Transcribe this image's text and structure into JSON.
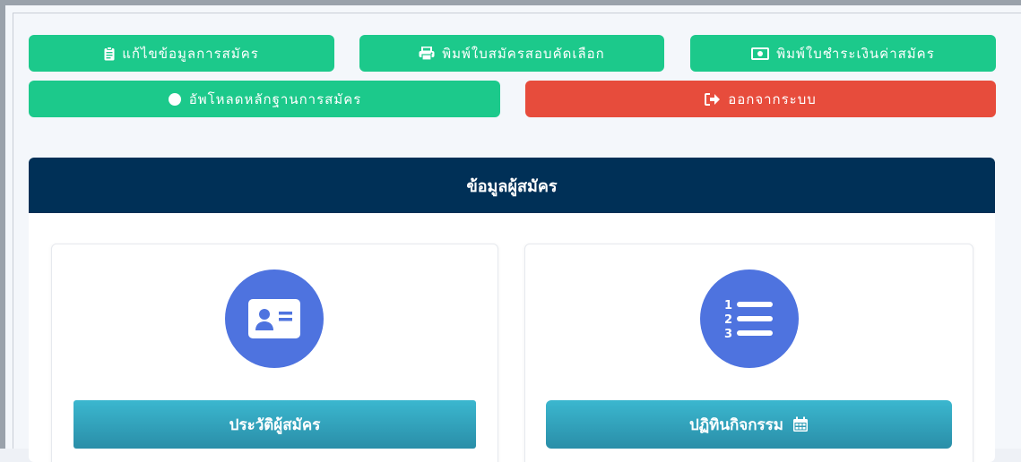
{
  "toolbar": {
    "edit_label": "แก้ไขข้อมูลการสมัคร",
    "print_form_label": "พิมพ์ใบสมัครสอบคัดเลือก",
    "print_payment_label": "พิมพ์ใบชำระเงินค่าสมัคร",
    "upload_label": "อัพโหลดหลักฐานการสมัคร",
    "logout_label": "ออกจากระบบ"
  },
  "panel": {
    "title": "ข้อมูลผู้สมัคร"
  },
  "cards": [
    {
      "label": "ประวัติผู้สมัคร",
      "icon": "id-card-icon"
    },
    {
      "label": "ปฏิทินกิจกรรม",
      "icon": "numbered-list-icon",
      "trailing_icon": "calendar-icon"
    }
  ],
  "colors": {
    "green": "#1cc98b",
    "red": "#e74c3c",
    "header": "#003057",
    "icon_circle": "#4e73df",
    "teal": "#3bb7cf"
  }
}
